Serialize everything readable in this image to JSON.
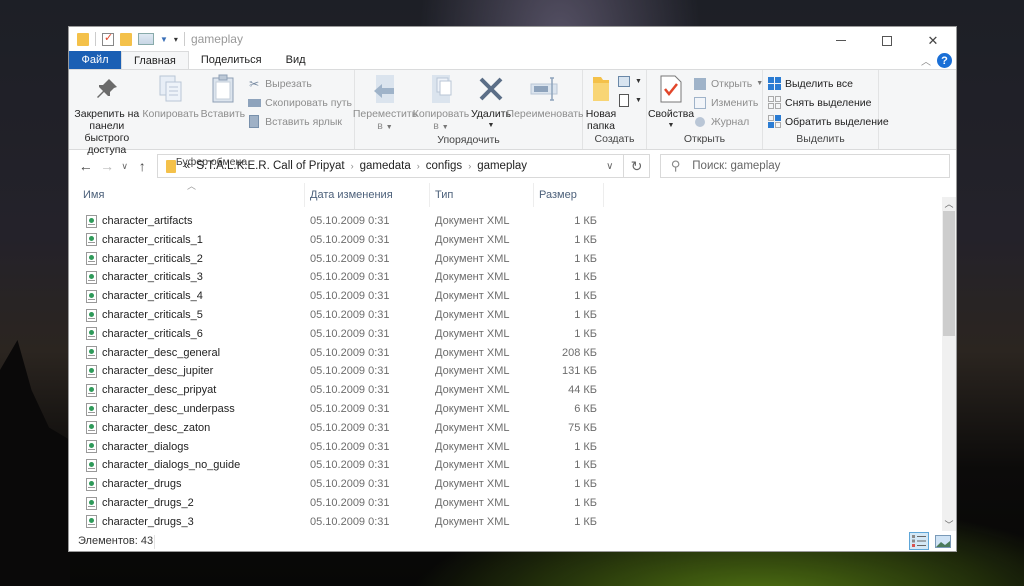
{
  "window": {
    "title": "gameplay"
  },
  "ribbon_tabs": [
    {
      "label": "Файл"
    },
    {
      "label": "Главная"
    },
    {
      "label": "Поделиться"
    },
    {
      "label": "Вид"
    }
  ],
  "ribbon": {
    "clipboard": {
      "label": "Буфер обмена",
      "pin": "Закрепить на панели быстрого доступа",
      "pin_line1": "Закрепить на панели",
      "pin_line2": "быстрого доступа",
      "copy": "Копировать",
      "paste": "Вставить",
      "cut": "Вырезать",
      "copy_path": "Скопировать путь",
      "paste_shortcut": "Вставить ярлык"
    },
    "organize": {
      "label": "Упорядочить",
      "move_to_line1": "Переместить",
      "move_to_line2": "в",
      "copy_to_line1": "Копировать",
      "copy_to_line2": "в",
      "delete": "Удалить",
      "rename": "Переименовать"
    },
    "new": {
      "label": "Создать",
      "new_folder_line1": "Новая",
      "new_folder_line2": "папка"
    },
    "open": {
      "label": "Открыть",
      "properties": "Свойства",
      "open": "Открыть",
      "edit": "Изменить",
      "history": "Журнал"
    },
    "select": {
      "label": "Выделить",
      "select_all": "Выделить все",
      "select_none": "Снять выделение",
      "invert": "Обратить выделение"
    }
  },
  "address": {
    "overflow": "«",
    "crumbs": [
      "S.T.A.L.K.E.R. Call of Pripyat",
      "gamedata",
      "configs",
      "gameplay"
    ]
  },
  "search": {
    "placeholder": "Поиск: gameplay"
  },
  "columns": {
    "name": "Имя",
    "date": "Дата изменения",
    "type": "Тип",
    "size": "Размер"
  },
  "files": [
    {
      "name": "character_artifacts",
      "date": "05.10.2009 0:31",
      "type": "Документ XML",
      "size": "1 КБ"
    },
    {
      "name": "character_criticals_1",
      "date": "05.10.2009 0:31",
      "type": "Документ XML",
      "size": "1 КБ"
    },
    {
      "name": "character_criticals_2",
      "date": "05.10.2009 0:31",
      "type": "Документ XML",
      "size": "1 КБ"
    },
    {
      "name": "character_criticals_3",
      "date": "05.10.2009 0:31",
      "type": "Документ XML",
      "size": "1 КБ"
    },
    {
      "name": "character_criticals_4",
      "date": "05.10.2009 0:31",
      "type": "Документ XML",
      "size": "1 КБ"
    },
    {
      "name": "character_criticals_5",
      "date": "05.10.2009 0:31",
      "type": "Документ XML",
      "size": "1 КБ"
    },
    {
      "name": "character_criticals_6",
      "date": "05.10.2009 0:31",
      "type": "Документ XML",
      "size": "1 КБ"
    },
    {
      "name": "character_desc_general",
      "date": "05.10.2009 0:31",
      "type": "Документ XML",
      "size": "208 КБ"
    },
    {
      "name": "character_desc_jupiter",
      "date": "05.10.2009 0:31",
      "type": "Документ XML",
      "size": "131 КБ"
    },
    {
      "name": "character_desc_pripyat",
      "date": "05.10.2009 0:31",
      "type": "Документ XML",
      "size": "44 КБ"
    },
    {
      "name": "character_desc_underpass",
      "date": "05.10.2009 0:31",
      "type": "Документ XML",
      "size": "6 КБ"
    },
    {
      "name": "character_desc_zaton",
      "date": "05.10.2009 0:31",
      "type": "Документ XML",
      "size": "75 КБ"
    },
    {
      "name": "character_dialogs",
      "date": "05.10.2009 0:31",
      "type": "Документ XML",
      "size": "1 КБ"
    },
    {
      "name": "character_dialogs_no_guide",
      "date": "05.10.2009 0:31",
      "type": "Документ XML",
      "size": "1 КБ"
    },
    {
      "name": "character_drugs",
      "date": "05.10.2009 0:31",
      "type": "Документ XML",
      "size": "1 КБ"
    },
    {
      "name": "character_drugs_2",
      "date": "05.10.2009 0:31",
      "type": "Документ XML",
      "size": "1 КБ"
    },
    {
      "name": "character_drugs_3",
      "date": "05.10.2009 0:31",
      "type": "Документ XML",
      "size": "1 КБ"
    }
  ],
  "status": {
    "items": "Элементов: 43"
  },
  "colors": {
    "file_tab": "#1a5fb4",
    "help": "#1a6fd6",
    "column_header": "#4c607a"
  }
}
